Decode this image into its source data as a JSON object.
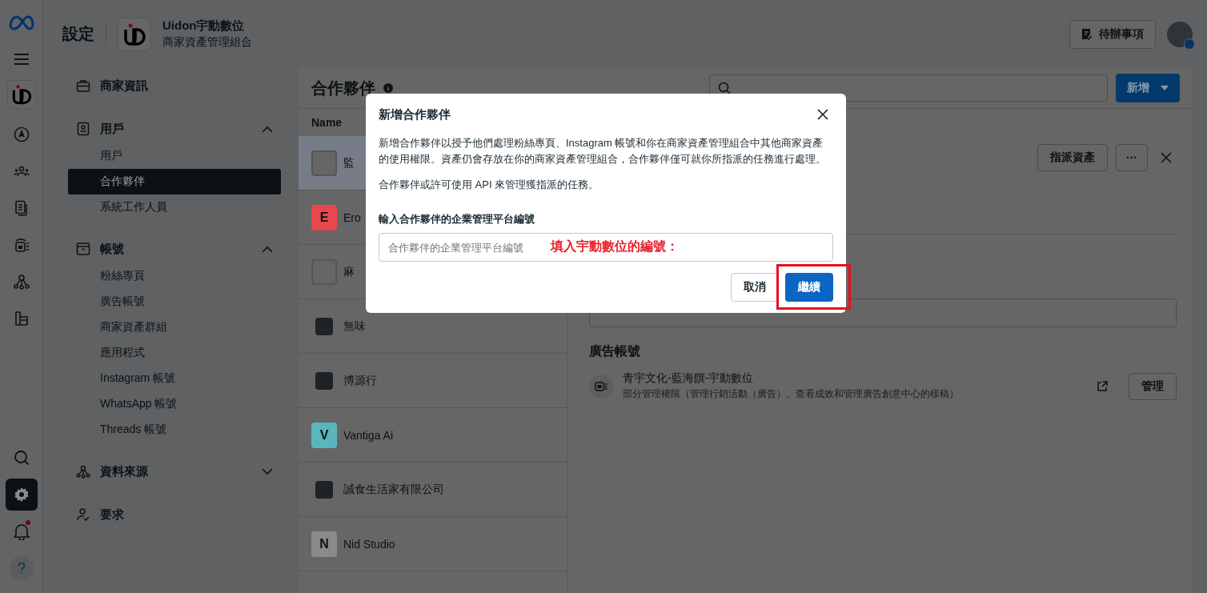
{
  "rail": {
    "items": [
      {
        "kind": "meta",
        "selected": false,
        "notification": false
      },
      {
        "kind": "menu",
        "selected": false,
        "notification": false
      },
      {
        "kind": "brand",
        "selected": false,
        "notification": false
      },
      {
        "kind": "compass",
        "selected": false,
        "notification": false
      },
      {
        "kind": "people",
        "selected": false,
        "notification": false
      },
      {
        "kind": "document",
        "selected": false,
        "notification": false
      },
      {
        "kind": "inventory",
        "selected": false,
        "notification": false
      },
      {
        "kind": "network",
        "selected": false,
        "notification": false
      },
      {
        "kind": "database",
        "selected": false,
        "notification": false
      },
      {
        "kind": "search",
        "selected": false,
        "notification": false
      },
      {
        "kind": "settings",
        "selected": true,
        "notification": false
      },
      {
        "kind": "bell",
        "selected": false,
        "notification": true
      },
      {
        "kind": "help",
        "selected": false,
        "notification": false
      }
    ]
  },
  "header": {
    "title": "設定",
    "business_name": "Uidon宇動數位",
    "business_subtitle": "商家資產管理組合",
    "todo_button": "待辦事項"
  },
  "sidebar": {
    "sections": [
      {
        "kind": "link",
        "label": "商家資訊"
      },
      {
        "kind": "group",
        "label": "用戶",
        "expanded": true,
        "items": [
          {
            "label": "用戶",
            "selected": false
          },
          {
            "label": "合作夥伴",
            "selected": true
          },
          {
            "label": "系統工作人員",
            "selected": false
          }
        ]
      },
      {
        "kind": "group",
        "label": "帳號",
        "expanded": true,
        "items": [
          {
            "label": "粉絲專頁",
            "selected": false
          },
          {
            "label": "廣告帳號",
            "selected": false
          },
          {
            "label": "商家資產群組",
            "selected": false
          },
          {
            "label": "應用程式",
            "selected": false
          },
          {
            "label": "Instagram 帳號",
            "selected": false
          },
          {
            "label": "WhatsApp 帳號",
            "selected": false
          },
          {
            "label": "Threads 帳號",
            "selected": false
          }
        ]
      },
      {
        "kind": "group",
        "label": "資料來源",
        "expanded": false
      },
      {
        "kind": "link",
        "label": "要求"
      }
    ]
  },
  "partners": {
    "title": "合作夥伴",
    "add_button": "新增",
    "column": "Name",
    "rows": [
      {
        "name": "監",
        "kind": "blank",
        "selected": true
      },
      {
        "name": "Ero",
        "kind": "letter",
        "letter": "E",
        "color": "#e5484d",
        "selected": false
      },
      {
        "name": "麻",
        "kind": "blank",
        "selected": false
      },
      {
        "name": "無味",
        "kind": "logo",
        "selected": false
      },
      {
        "name": "博源行",
        "kind": "logo",
        "selected": false
      },
      {
        "name": "Vantiga Ai",
        "kind": "letter",
        "letter": "V",
        "color": "#58b7bc",
        "selected": false
      },
      {
        "name": "誠食生活家有限公司",
        "kind": "logo",
        "selected": false
      },
      {
        "name": "Nid Studio",
        "kind": "letter",
        "letter": "N",
        "color": "#8a8a8a",
        "selected": false
      }
    ]
  },
  "detail": {
    "assign_button": "指派資產",
    "more_button": "···",
    "section_title": "廣告帳號",
    "account": {
      "name": "青宇文化-藍海饌-宇動數位",
      "description": "部分管理權限（管理行銷活動（廣告）、查看成效和管理廣告創意中心的樣稿）"
    },
    "manage_button": "管理"
  },
  "dialog": {
    "title": "新增合作夥伴",
    "paragraphs": [
      "新增合作夥伴以授予他們處理粉絲專頁、Instagram 帳號和你在商家資產管理組合中其他商家資產的使用權限。資產仍會存放在你的商家資產管理組合，合作夥伴僅可就你所指派的任務進行處理。",
      "合作夥伴或許可使用 API 來管理獲指派的任務。"
    ],
    "field_label": "輸入合作夥伴的企業管理平台編號",
    "field_placeholder": "合作夥伴的企業管理平台編號",
    "annotation": "填入宇動數位的編號：",
    "cancel_button": "取消",
    "continue_button": "繼續",
    "continue_highlighted": true
  }
}
